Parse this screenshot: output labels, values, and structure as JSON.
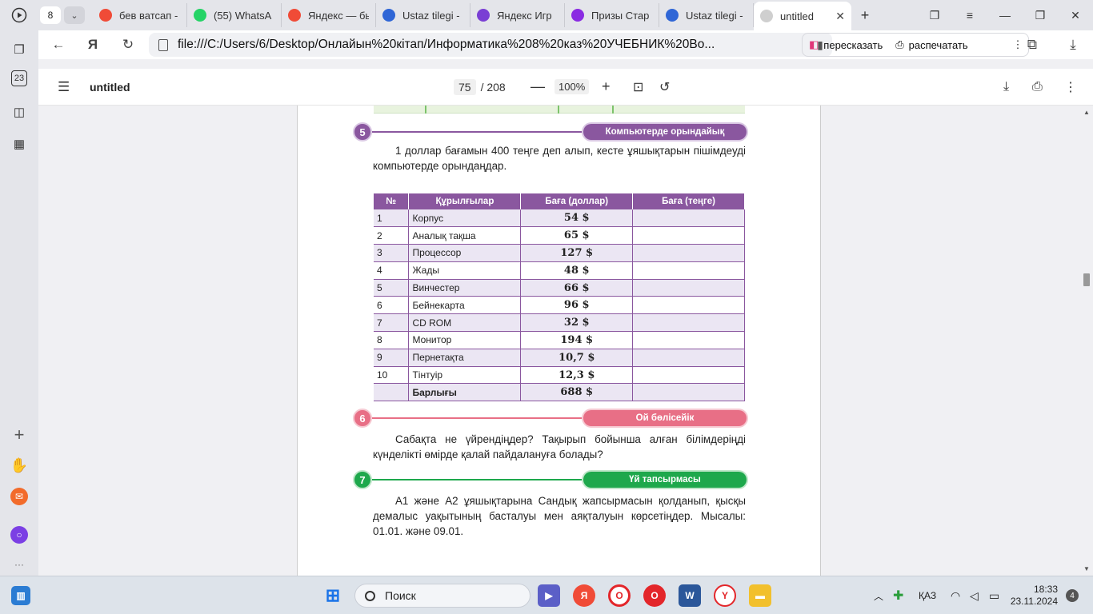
{
  "browser": {
    "tab_count": "8",
    "tabs": [
      {
        "label": "бев ватсап -",
        "icon": "yandex-search-icon",
        "color": "#f04b37"
      },
      {
        "label": "(55) WhatsA",
        "icon": "whatsapp-icon",
        "color": "#25d366"
      },
      {
        "label": "Яндекс — бы",
        "icon": "yandex-search-icon",
        "color": "#f04b37"
      },
      {
        "label": "Ustaz tilegi -",
        "icon": "ustaz-icon",
        "color": "#2f66d6"
      },
      {
        "label": "Яндекс Игр",
        "icon": "yandex-games-icon",
        "color": "#7a3fd4"
      },
      {
        "label": "Призы Стар",
        "icon": "prizes-icon",
        "color": "#8a2be2"
      },
      {
        "label": "Ustaz tilegi -",
        "icon": "ustaz-icon",
        "color": "#2f66d6"
      },
      {
        "label": "untitled",
        "icon": "document-icon",
        "color": "#cfcfcf",
        "active": true
      }
    ],
    "url": "file:///C:/Users/6/Desktop/Онлайын%20кітап/Информатика%208%20каз%20УЧЕБНИК%20Во...",
    "retell_label": "пересказать",
    "print_label": "распечатать"
  },
  "pdf": {
    "title": "untitled",
    "current_page": "75",
    "total_pages": "/ 208",
    "zoom": "100%"
  },
  "content": {
    "section5": {
      "num": "5",
      "pill": "Компьютерде орындайық",
      "text": "1 доллар бағамын 400 теңге деп алып, кесте ұяшықтарын пішімдеуді компьютерде орындаңдар."
    },
    "table": {
      "headers": [
        "№",
        "Құрылғылар",
        "Баға (доллар)",
        "Баға (теңге)"
      ],
      "rows": [
        [
          "1",
          "Корпус",
          "54 $",
          ""
        ],
        [
          "2",
          "Аналық тақша",
          "65 $",
          ""
        ],
        [
          "3",
          "Процессор",
          "127 $",
          ""
        ],
        [
          "4",
          "Жады",
          "48 $",
          ""
        ],
        [
          "5",
          "Винчестер",
          "66 $",
          ""
        ],
        [
          "6",
          "Бейнекарта",
          "96 $",
          ""
        ],
        [
          "7",
          "CD ROM",
          "32 $",
          ""
        ],
        [
          "8",
          "Монитор",
          "194 $",
          ""
        ],
        [
          "9",
          "Пернетақта",
          "10,7 $",
          ""
        ],
        [
          "10",
          "Тінтуір",
          "12,3 $",
          ""
        ]
      ],
      "total_label": "Барлығы",
      "total_value": "688 $"
    },
    "section6": {
      "num": "6",
      "pill": "Ой бөлісейік",
      "text": "Сабақта не үйрендіңдер? Тақырып бойынша алған білімдеріңді күнделікті өмірде қалай пайдалануға болады?"
    },
    "section7": {
      "num": "7",
      "pill": "Үй тапсырмасы",
      "text": "А1 және А2 ұяшықтарына Сандық жапсырмасын қолданып, қысқы демалыс уақытының басталуы мен аяқталуын көрсетіңдер. Мысалы: 01.01. және 09.01."
    }
  },
  "taskbar": {
    "search_label": "Поиск",
    "lang": "ҚАЗ",
    "time": "18:33",
    "date": "23.11.2024",
    "notifications": "4"
  },
  "colors": {
    "purple": "#8a579f",
    "pink": "#e86f86",
    "green": "#1ea84c"
  }
}
